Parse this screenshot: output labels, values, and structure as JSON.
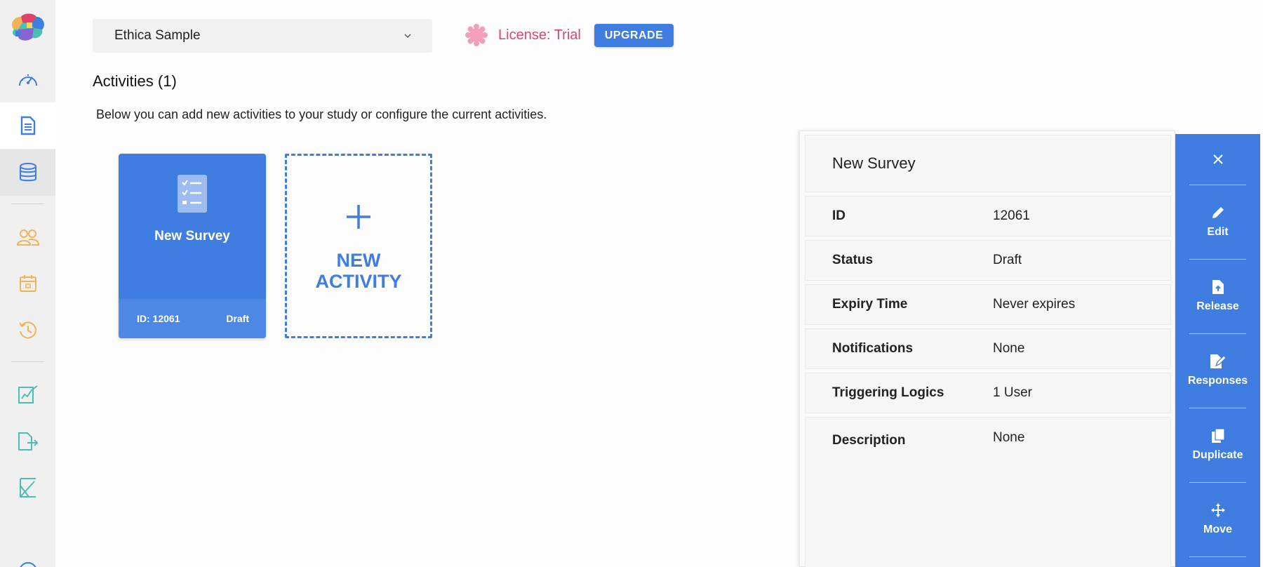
{
  "study": {
    "name": "Ethica Sample"
  },
  "license": {
    "text": "License: Trial",
    "upgrade_label": "UPGRADE"
  },
  "page": {
    "title": "Activities (1)",
    "description": "Below you can add new activities to your study or configure the current activities."
  },
  "activity_card": {
    "title": "New Survey",
    "id_label": "ID: 12061",
    "status": "Draft"
  },
  "new_activity": {
    "line1": "NEW",
    "line2": "ACTIVITY"
  },
  "detail": {
    "title": "New Survey",
    "rows": [
      {
        "label": "ID",
        "value": "12061"
      },
      {
        "label": "Status",
        "value": "Draft"
      },
      {
        "label": "Expiry Time",
        "value": "Never expires"
      },
      {
        "label": "Notifications",
        "value": "None"
      },
      {
        "label": "Triggering Logics",
        "value": "1 User"
      },
      {
        "label": "Description",
        "value": "None"
      }
    ]
  },
  "actions": [
    {
      "label": "Edit",
      "icon": "pencil-icon"
    },
    {
      "label": "Release",
      "icon": "file-upload-icon"
    },
    {
      "label": "Responses",
      "icon": "file-edit-icon"
    },
    {
      "label": "Duplicate",
      "icon": "copy-icon"
    },
    {
      "label": "Move",
      "icon": "move-icon"
    }
  ],
  "sidebar_icons": [
    "logo",
    "dashboard-icon",
    "document-icon",
    "database-icon",
    "participants-icon",
    "calendar-icon",
    "history-icon",
    "analytics-icon",
    "export-icon",
    "formula-icon",
    "help-icon"
  ],
  "colors": {
    "accent": "#3f7de0",
    "license": "#e0436a",
    "sidebar": "#f0f0f0",
    "orange_icons": "#efb35a",
    "teal_icons": "#4cc0b0"
  }
}
